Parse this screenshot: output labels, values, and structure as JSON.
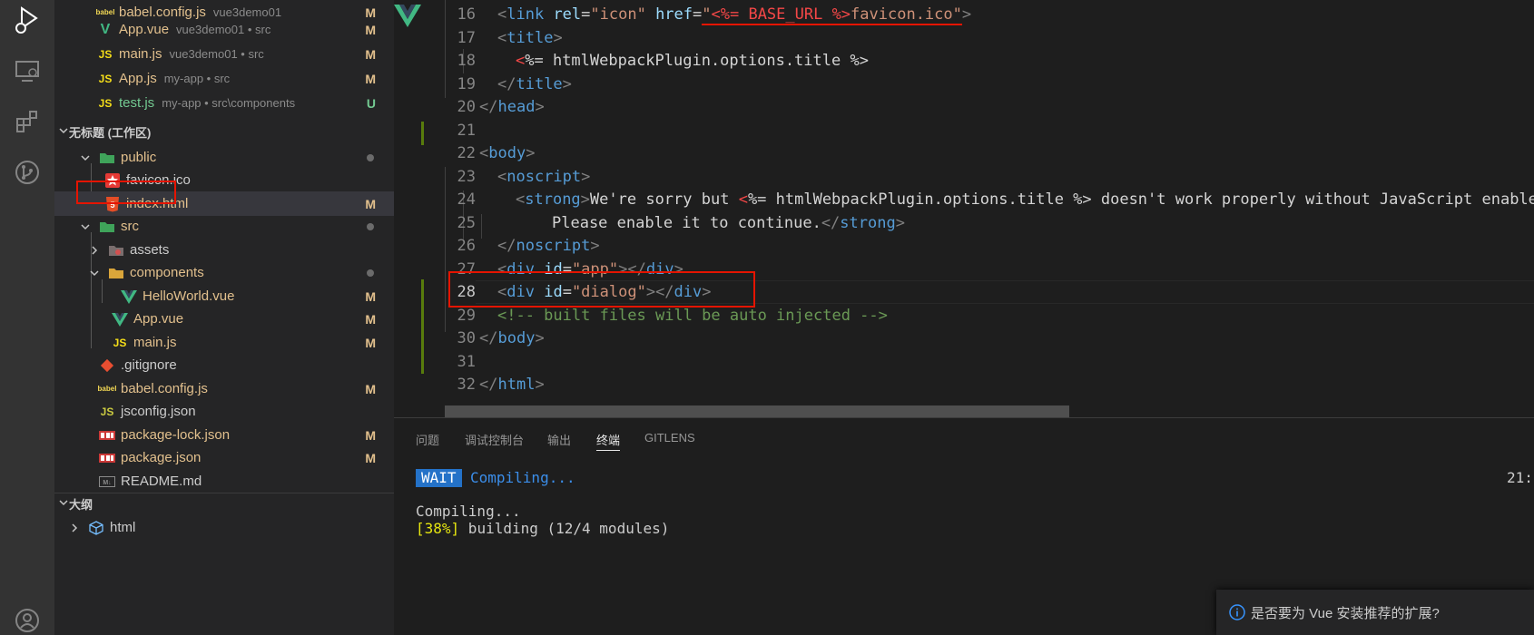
{
  "sidebar": {
    "open_editors": [
      {
        "icon": "babel-icon",
        "icon_text": "babel",
        "name": "babel.config.js",
        "desc": "vue3demo01",
        "badge": "M"
      },
      {
        "icon": "vue-icon",
        "icon_text": "V",
        "name": "App.vue",
        "desc": "vue3demo01 • src",
        "badge": "M"
      },
      {
        "icon": "js-icon",
        "icon_text": "JS",
        "name": "main.js",
        "desc": "vue3demo01 • src",
        "badge": "M"
      },
      {
        "icon": "js-icon",
        "icon_text": "JS",
        "name": "App.js",
        "desc": "my-app • src",
        "badge": "M"
      },
      {
        "icon": "js-icon",
        "icon_text": "JS",
        "name": "test.js",
        "desc": "my-app • src\\components",
        "badge": "U"
      }
    ],
    "workspace_title": "无标题 (工作区)",
    "tree": [
      {
        "label": "public"
      },
      {
        "label": "favicon.ico"
      },
      {
        "label": "index.html",
        "badge": "M"
      },
      {
        "label": "src"
      },
      {
        "label": "assets"
      },
      {
        "label": "components"
      },
      {
        "label": "HelloWorld.vue",
        "badge": "M"
      },
      {
        "label": "App.vue",
        "badge": "M"
      },
      {
        "label": "main.js",
        "badge": "M"
      },
      {
        "label": ".gitignore"
      },
      {
        "label": "babel.config.js",
        "badge": "M"
      },
      {
        "label": "jsconfig.json"
      },
      {
        "label": "package-lock.json",
        "badge": "M"
      },
      {
        "label": "package.json",
        "badge": "M"
      },
      {
        "label": "README.md"
      }
    ],
    "outline_title": "大纲",
    "outline_item": "html"
  },
  "editor": {
    "line_numbers": [
      "16",
      "17",
      "18",
      "19",
      "20",
      "21",
      "22",
      "23",
      "24",
      "25",
      "26",
      "27",
      "28",
      "29",
      "30",
      "31",
      "32"
    ],
    "code": {
      "l16": {
        "open": "<",
        "tag": "link",
        "a1": " rel",
        "eq1": "=",
        "v1": "\"icon\"",
        "a2": " href",
        "eq2": "=",
        "v2a": "\"",
        "v2b": "<%= BASE_URL %>",
        "v2c": "favicon.ico\"",
        "close": ">"
      },
      "l17": {
        "open": "<",
        "tag": "title",
        "close": ">"
      },
      "l18": {
        "mark": "<",
        "text": "%= htmlWebpackPlugin.options.title %>"
      },
      "l19": {
        "open": "</",
        "tag": "title",
        "close": ">"
      },
      "l20": {
        "open": "</",
        "tag": "head",
        "close": ">"
      },
      "l22": {
        "open": "<",
        "tag": "body",
        "close": ">"
      },
      "l23": {
        "open": "<",
        "tag": "noscript",
        "close": ">"
      },
      "l24": {
        "open": "<",
        "tag": "strong",
        "close": ">",
        "text1": "We're sorry but ",
        "mark": "<",
        "text2": "%= htmlWebpackPlugin.options.title %> doesn't work properly without JavaScript enabled."
      },
      "l25": {
        "text": "Please enable it to continue.",
        "open": "</",
        "tag": "strong",
        "close": ">"
      },
      "l26": {
        "open": "</",
        "tag": "noscript",
        "close": ">"
      },
      "l27": {
        "open": "<",
        "tag": "div",
        "attr": " id",
        "eq": "=",
        "val": "\"app\"",
        "mid": "></",
        "tag2": "div",
        "close": ">"
      },
      "l28": {
        "open": "<",
        "tag": "div",
        "attr": " id",
        "eq": "=",
        "val": "\"dialog\"",
        "mid": "></",
        "tag2": "div",
        "close": ">"
      },
      "l29": {
        "comment": "<!-- built files will be auto injected -->"
      },
      "l30": {
        "open": "</",
        "tag": "body",
        "close": ">"
      },
      "l32": {
        "open": "</",
        "tag": "html",
        "close": ">"
      }
    }
  },
  "panel": {
    "tabs": [
      "问题",
      "调试控制台",
      "输出",
      "终端",
      "GITLENS"
    ],
    "active_tab": "终端",
    "wait_badge": "WAIT",
    "wait_text": "Compiling...",
    "time": "21:",
    "line1": "Compiling...",
    "progress": "[38%]",
    "building": " building (12/4 modules)"
  },
  "notification": {
    "text": "是否要为 Vue 安装推荐的扩展?"
  },
  "colors": {
    "activity_bar": "#333333",
    "sidebar": "#252526",
    "editor": "#1e1e1e",
    "tag": "#569cd6",
    "attr": "#9cdcfe",
    "string": "#ce9178",
    "comment": "#6a9955",
    "modified": "#e2c08d",
    "untracked": "#73c991",
    "highlight": "#e51400"
  }
}
